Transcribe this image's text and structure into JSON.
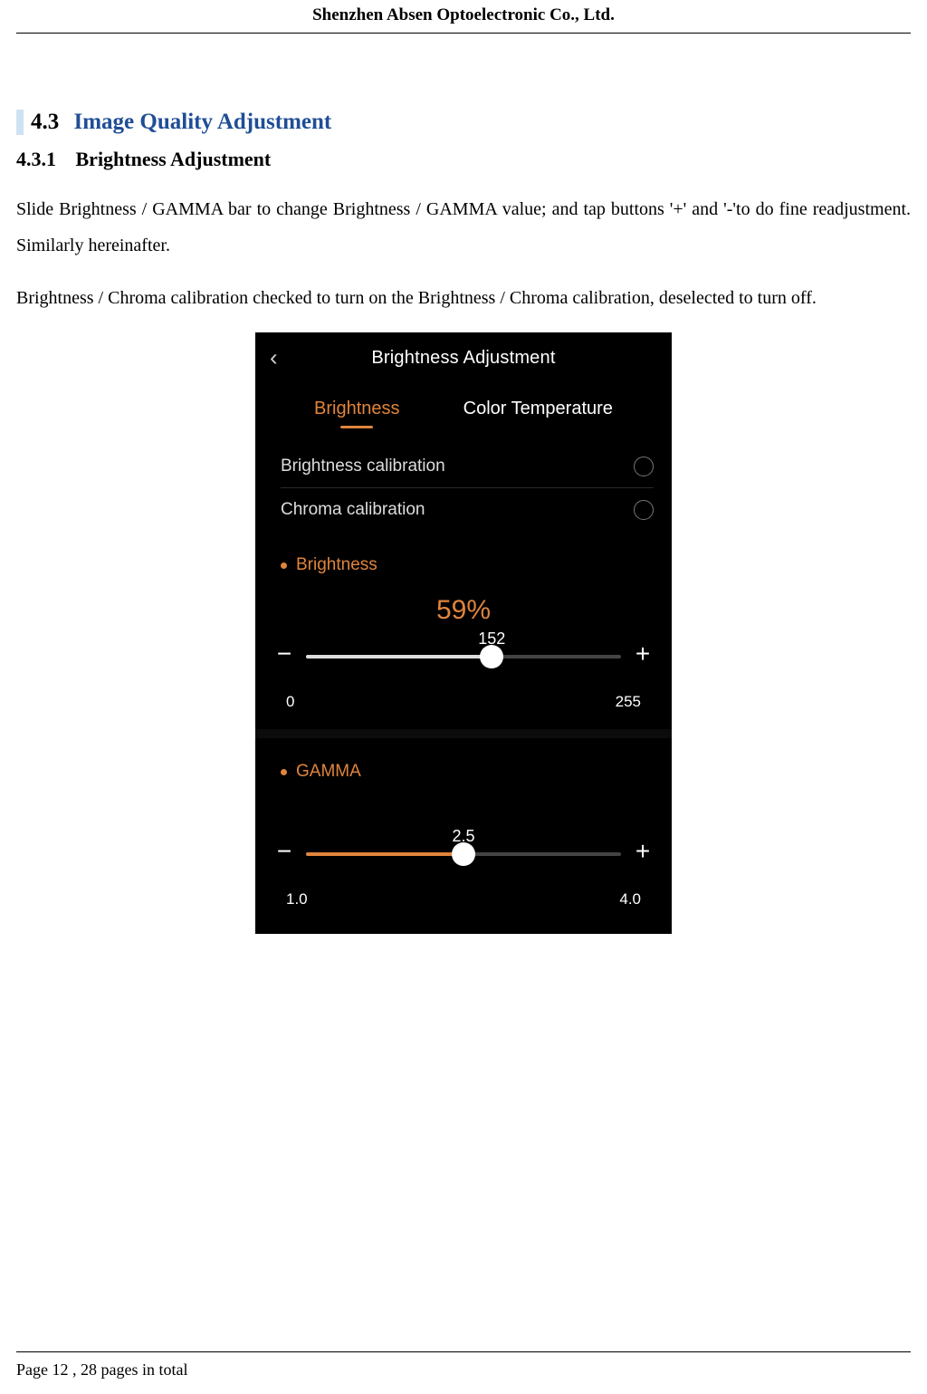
{
  "doc": {
    "company": "Shenzhen Absen Optoelectronic Co., Ltd.",
    "footer": "Page 12 , 28 pages in total",
    "h2_num": "4.3",
    "h2_title": "Image Quality Adjustment",
    "h3_num": "4.3.1",
    "h3_title": "Brightness Adjustment",
    "para1": "Slide Brightness / GAMMA bar to change Brightness / GAMMA value; and tap buttons '+' and '-'to do fine readjustment. Similarly hereinafter.",
    "para2": "Brightness / Chroma calibration checked to turn on the Brightness / Chroma calibration, deselected to turn off."
  },
  "phone": {
    "title": "Brightness Adjustment",
    "tabs": {
      "active": "Brightness",
      "inactive": "Color Temperature"
    },
    "rows": {
      "r1": "Brightness calibration",
      "r2": "Chroma calibration"
    },
    "brightness": {
      "label": "Brightness",
      "percent": "59%",
      "value": "152",
      "min": "0",
      "max": "255",
      "minus": "−",
      "plus": "+"
    },
    "gamma": {
      "label": "GAMMA",
      "value": "2.5",
      "min": "1.0",
      "max": "4.0",
      "minus": "−",
      "plus": "+"
    }
  }
}
